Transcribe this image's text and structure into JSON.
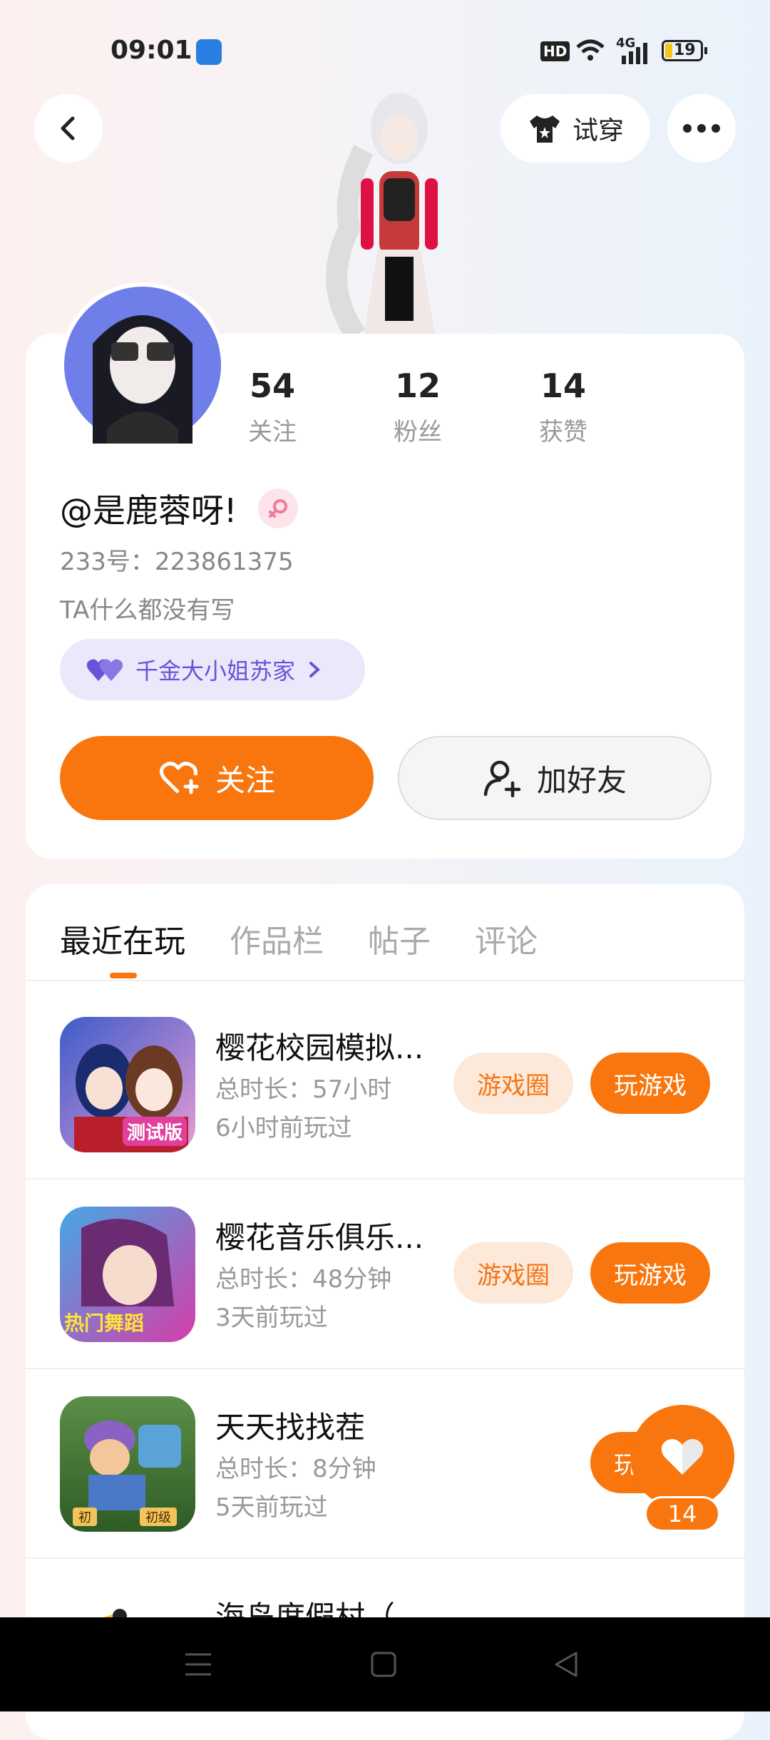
{
  "status_bar": {
    "time": "09:01",
    "battery": "19",
    "network": "4G",
    "hd": "HD"
  },
  "header": {
    "tryon_label": "试穿"
  },
  "profile": {
    "stats": [
      {
        "num": "54",
        "label": "关注"
      },
      {
        "num": "12",
        "label": "粉丝"
      },
      {
        "num": "14",
        "label": "获赞"
      }
    ],
    "username": "@是鹿蓉呀!",
    "id_text": "233号：223861375",
    "bio": "TA什么都没有写",
    "tag_label": "千金大小姐苏家",
    "follow_label": "关注",
    "add_friend_label": "加好友"
  },
  "tabs": [
    "最近在玩",
    "作品栏",
    "帖子",
    "评论"
  ],
  "games": [
    {
      "title": "樱花校园模拟...",
      "duration": "总时长：57小时",
      "last": "6小时前玩过",
      "circle_label": "游戏圈",
      "play_label": "玩游戏",
      "badge": "测试版"
    },
    {
      "title": "樱花音乐俱乐...",
      "duration": "总时长：48分钟",
      "last": "3天前玩过",
      "circle_label": "游戏圈",
      "play_label": "玩游戏",
      "badge": "热门舞蹈"
    },
    {
      "title": "天天找找茬",
      "duration": "总时长：8分钟",
      "last": "5天前玩过",
      "play_label": "玩游戏",
      "badge_left": "初",
      "badge_right": "初级"
    },
    {
      "title": "海岛度假村（"
    }
  ],
  "floating": {
    "count": "14"
  },
  "colors": {
    "accent": "#f8760d",
    "tag_bg": "#ebe8fb",
    "tag_text": "#6a53d8"
  }
}
